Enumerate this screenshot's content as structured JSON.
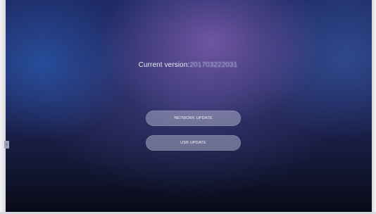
{
  "version": {
    "label": "Current version:",
    "value": "201703222031"
  },
  "buttons": {
    "network_update": "NETWORK UPDATE",
    "usb_update": "USB UPDATE"
  },
  "side_handle": {
    "icon": "chevron-right-icon",
    "glyph": "›"
  },
  "colors": {
    "background_top": "#1d2a66",
    "background_glow": "#7c5caa",
    "background_bottom": "#080a16",
    "button_fill": "#aaacc4",
    "text": "#e9ecf6"
  }
}
